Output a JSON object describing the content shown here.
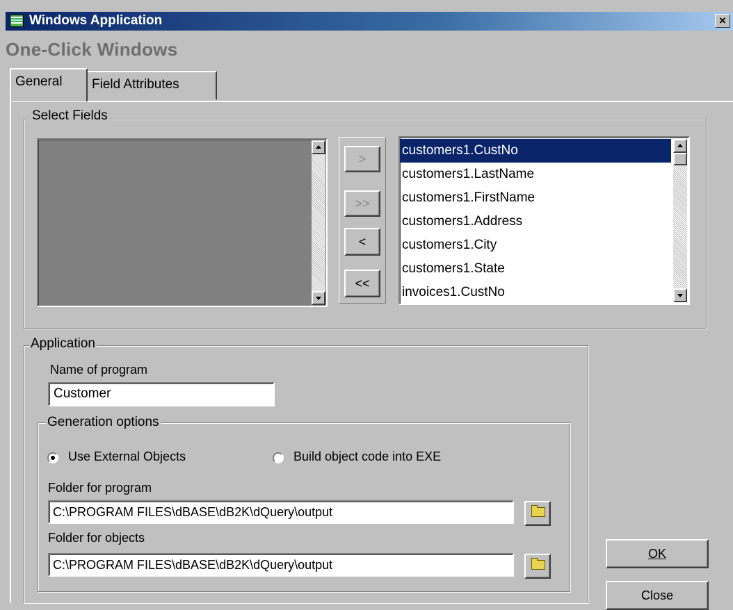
{
  "window": {
    "title": "Windows Application",
    "close_label": "×"
  },
  "heading": "One-Click Windows",
  "tabs": [
    {
      "label": "General",
      "active": true
    },
    {
      "label": "Field Attributes",
      "active": false
    }
  ],
  "select_fields": {
    "legend": "Select Fields",
    "available": [],
    "selected": [
      "customers1.CustNo",
      "customers1.LastName",
      "customers1.FirstName",
      "customers1.Address",
      "customers1.City",
      "customers1.State",
      "invoices1.CustNo"
    ],
    "selected_index": 0,
    "buttons": {
      "add_one": ">",
      "add_all": ">>",
      "remove_one": "<",
      "remove_all": "<<"
    }
  },
  "application": {
    "legend": "Application",
    "name_label": "Name of program",
    "name_value": "Customer",
    "generation": {
      "legend": "Generation options",
      "option_external": "Use External Objects",
      "option_build": "Build object code into EXE",
      "selected": "external",
      "folder_program_label": "Folder for program",
      "folder_program_value": "C:\\PROGRAM FILES\\dBASE\\dB2K\\dQuery\\output",
      "folder_objects_label": "Folder for objects",
      "folder_objects_value": "C:\\PROGRAM FILES\\dBASE\\dB2K\\dQuery\\output"
    }
  },
  "actions": {
    "ok": "OK",
    "close": "Close"
  },
  "colors": {
    "titlebar": "#0a246a",
    "selection": "#0a246a",
    "face": "#c0c0c0"
  }
}
